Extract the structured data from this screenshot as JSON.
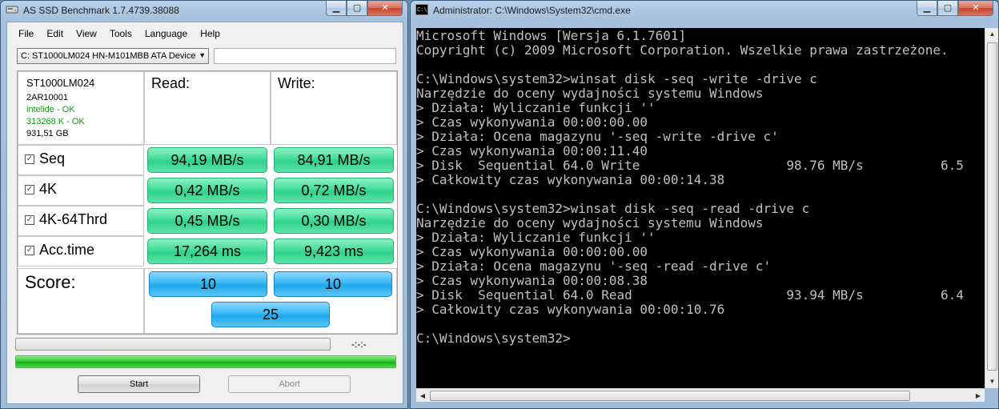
{
  "asssd": {
    "title": "AS SSD Benchmark 1.7.4739.38088",
    "menu": [
      "File",
      "Edit",
      "View",
      "Tools",
      "Language",
      "Help"
    ],
    "device": "C: ST1000LM024 HN-M101MBB ATA Device",
    "info": {
      "model": "ST1000LM024",
      "firmware": "2AR10001",
      "driver": "intelide - OK",
      "alignment": "313268 K - OK",
      "size": "931,51 GB"
    },
    "headers": {
      "read": "Read:",
      "write": "Write:"
    },
    "rows": [
      {
        "label": "Seq",
        "read": "94,19 MB/s",
        "write": "84,91 MB/s"
      },
      {
        "label": "4K",
        "read": "0,42 MB/s",
        "write": "0,72 MB/s"
      },
      {
        "label": "4K-64Thrd",
        "read": "0,45 MB/s",
        "write": "0,30 MB/s"
      },
      {
        "label": "Acc.time",
        "read": "17,264 ms",
        "write": "9,423 ms"
      }
    ],
    "score": {
      "label": "Score:",
      "read": "10",
      "write": "10",
      "total": "25"
    },
    "elapsed": "-:-:-",
    "progress_fraction": 1.0,
    "buttons": {
      "start": "Start",
      "abort": "Abort"
    },
    "colors": {
      "result": "#42dc98",
      "score": "#39b8f2",
      "ok": "#1a9a1a"
    }
  },
  "cmd": {
    "title": "Administrator: C:\\Windows\\System32\\cmd.exe",
    "lines": [
      "Microsoft Windows [Wersja 6.1.7601]",
      "Copyright (c) 2009 Microsoft Corporation. Wszelkie prawa zastrzeżone.",
      "",
      "C:\\Windows\\system32>winsat disk -seq -write -drive c",
      "Narzędzie do oceny wydajności systemu Windows",
      "> Działa: Wyliczanie funkcji ''",
      "> Czas wykonywania 00:00:00.00",
      "> Działa: Ocena magazynu '-seq -write -drive c'",
      "> Czas wykonywania 00:00:11.40",
      "> Disk  Sequential 64.0 Write                   98.76 MB/s          6.5",
      "> Całkowity czas wykonywania 00:00:14.38",
      "",
      "C:\\Windows\\system32>winsat disk -seq -read -drive c",
      "Narzędzie do oceny wydajności systemu Windows",
      "> Działa: Wyliczanie funkcji ''",
      "> Czas wykonywania 00:00:00.00",
      "> Działa: Ocena magazynu '-seq -read -drive c'",
      "> Czas wykonywania 00:00:08.38",
      "> Disk  Sequential 64.0 Read                    93.94 MB/s          6.4",
      "> Całkowity czas wykonywania 00:00:10.76",
      "",
      "C:\\Windows\\system32>"
    ]
  }
}
